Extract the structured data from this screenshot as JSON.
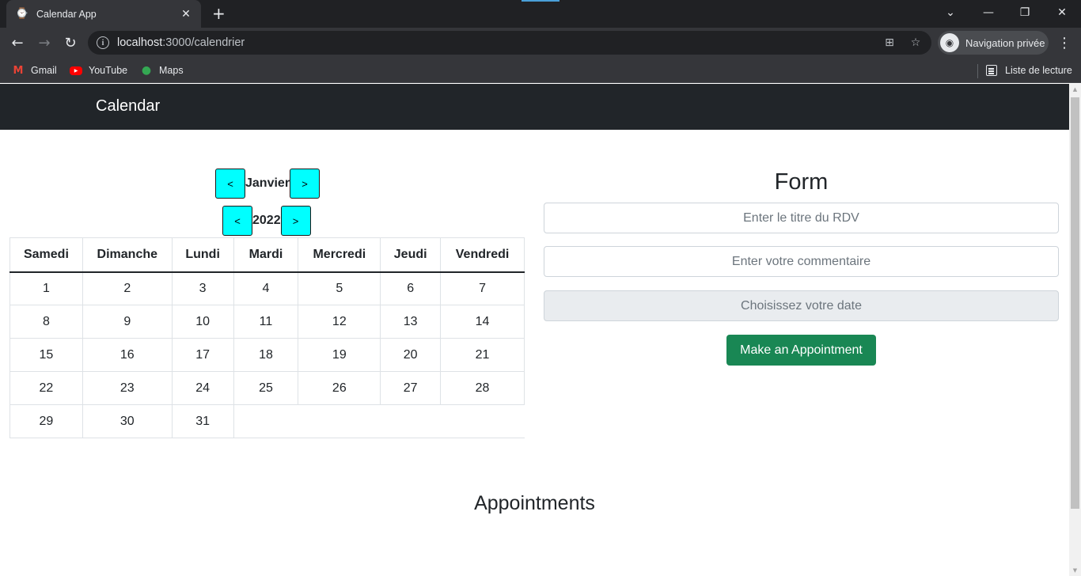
{
  "browser": {
    "tab_title": "Calendar App",
    "url_host": "localhost",
    "url_rest": ":3000/calendrier",
    "profile_label": "Navigation privée",
    "bookmarks": [
      {
        "label": "Gmail",
        "icon": "gmail-icon"
      },
      {
        "label": "YouTube",
        "icon": "youtube-icon"
      },
      {
        "label": "Maps",
        "icon": "maps-icon"
      }
    ],
    "reading_list": "Liste de lecture"
  },
  "navbar": {
    "brand": "Calendar"
  },
  "calendar": {
    "month": "Janvier",
    "year": "2022",
    "prev_label": "<",
    "next_label": ">",
    "weekdays": [
      "Samedi",
      "Dimanche",
      "Lundi",
      "Mardi",
      "Mercredi",
      "Jeudi",
      "Vendredi"
    ],
    "weeks": [
      [
        "1",
        "2",
        "3",
        "4",
        "5",
        "6",
        "7"
      ],
      [
        "8",
        "9",
        "10",
        "11",
        "12",
        "13",
        "14"
      ],
      [
        "15",
        "16",
        "17",
        "18",
        "19",
        "20",
        "21"
      ],
      [
        "22",
        "23",
        "24",
        "25",
        "26",
        "27",
        "28"
      ],
      [
        "29",
        "30",
        "31",
        "",
        "",
        "",
        ""
      ]
    ]
  },
  "form": {
    "title": "Form",
    "title_placeholder": "Enter le titre du RDV",
    "comment_placeholder": "Enter votre commentaire",
    "date_placeholder": "Choisissez votre date",
    "submit_label": "Make an Appointment"
  },
  "appointments": {
    "title": "Appointments"
  },
  "colors": {
    "navbar_bg": "#212529",
    "nav_button": "#00ffff",
    "submit_button": "#198754"
  }
}
